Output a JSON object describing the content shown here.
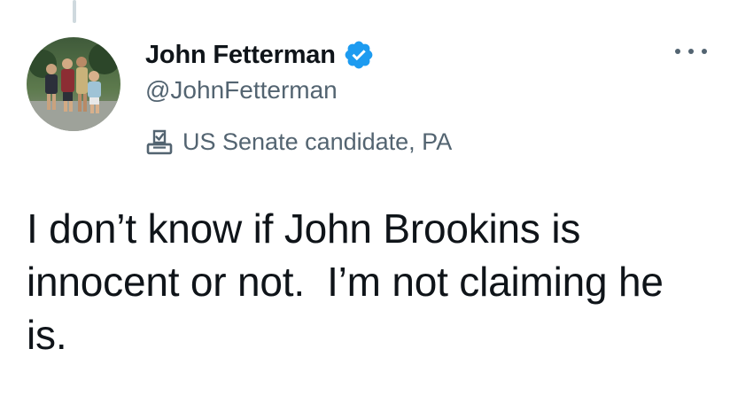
{
  "author": {
    "display_name": "John Fetterman",
    "handle": "@JohnFetterman",
    "affiliation_label": "US Senate candidate, PA",
    "verified": true,
    "verified_color": "#1d9bf0"
  },
  "tweet": {
    "text": "I don’t know if John Brookins is innocent or not.  I’m not claiming he is."
  },
  "icons": {
    "avatar": "profile-photo",
    "verified": "verified-badge-icon",
    "label": "ballot-box-icon",
    "more": "more-options-icon"
  },
  "colors": {
    "text_primary": "#0f1419",
    "text_secondary": "#536471"
  }
}
